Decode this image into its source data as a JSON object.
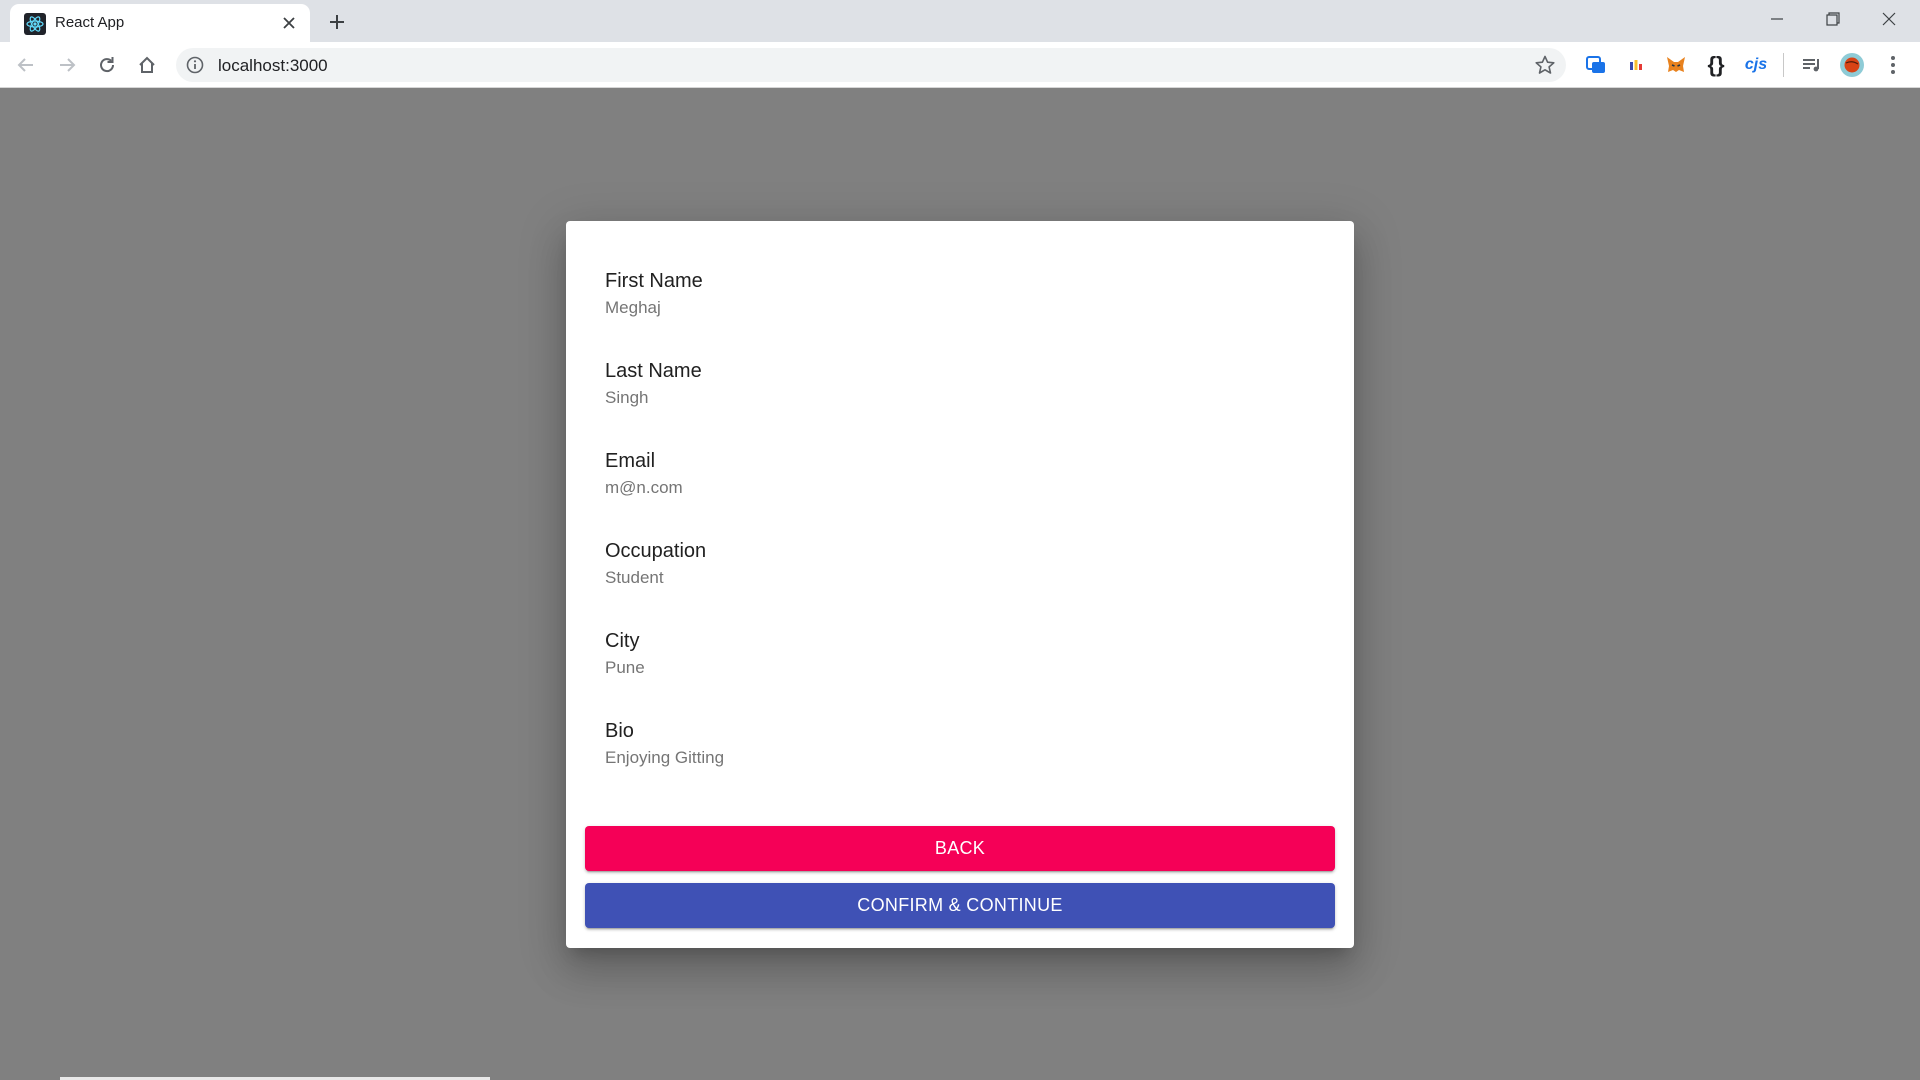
{
  "browser": {
    "tab_title": "React App",
    "url": "localhost:3000",
    "extensions": [
      "screen-capture-extension-icon",
      "color-bars-extension-icon",
      "metamask-fox-icon",
      "json-braces-extension-icon",
      "cjs-extension-icon"
    ],
    "ext_cjs_label": "cjs",
    "ext_braces_label": "{}"
  },
  "review": {
    "items": [
      {
        "label": "First Name",
        "value": "Meghaj"
      },
      {
        "label": "Last Name",
        "value": "Singh"
      },
      {
        "label": "Email",
        "value": "m@n.com"
      },
      {
        "label": "Occupation",
        "value": "Student"
      },
      {
        "label": "City",
        "value": "Pune"
      },
      {
        "label": "Bio",
        "value": "Enjoying Gitting"
      }
    ],
    "back_label": "BACK",
    "confirm_label": "CONFIRM & CONTINUE"
  },
  "colors": {
    "back_button": "#f50057",
    "confirm_button": "#3f51b5",
    "overlay": "#808080"
  }
}
